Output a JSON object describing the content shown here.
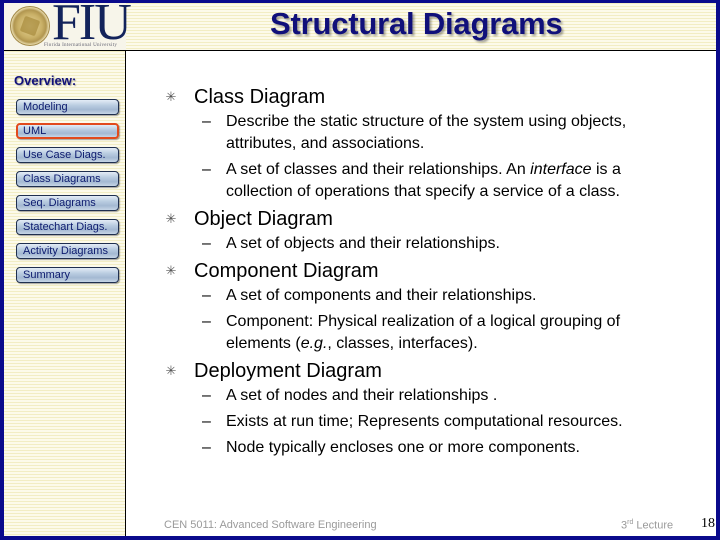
{
  "header": {
    "title": "Structural Diagrams",
    "logo_text": "FIU",
    "logo_subtitle": "Florida International University"
  },
  "sidebar": {
    "overview_label": "Overview:",
    "items": [
      {
        "label": "Modeling",
        "active": false
      },
      {
        "label": "UML",
        "active": true
      },
      {
        "label": "Use Case Diags.",
        "active": false
      },
      {
        "label": "Class Diagrams",
        "active": false
      },
      {
        "label": "Seq. Diagrams",
        "active": false
      },
      {
        "label": "Statechart Diags.",
        "active": false
      },
      {
        "label": "Activity Diagrams",
        "active": false
      },
      {
        "label": "Summary",
        "active": false
      }
    ]
  },
  "content": {
    "bullet_icon": "star-burst-icon",
    "dash": "–",
    "bullets": [
      {
        "heading": "Class Diagram",
        "subs": [
          {
            "text": "Describe the static structure of the system using objects, attributes, and associations."
          },
          {
            "pre": "A set of classes and their relationships. An ",
            "italic": "interface",
            "post": " is a collection of operations that specify a service of a class."
          }
        ]
      },
      {
        "heading": "Object Diagram",
        "subs": [
          {
            "text": "A set of objects and their relationships."
          }
        ]
      },
      {
        "heading": "Component Diagram",
        "subs": [
          {
            "text": "A set of components and their relationships."
          },
          {
            "pre": "Component: Physical realization of a logical grouping of elements (",
            "italic": "e.g.",
            "post": ", classes, interfaces)."
          }
        ]
      },
      {
        "heading": "Deployment Diagram",
        "subs": [
          {
            "text": "A set of nodes and their relationships  ."
          },
          {
            "text": "Exists at run time; Represents computational resources."
          },
          {
            "text": "Node typically encloses one or more components."
          }
        ]
      }
    ]
  },
  "footer": {
    "course": "CEN 5011: Advanced Software Engineering",
    "lecture_num": "3",
    "lecture_sup": "rd",
    "lecture_word": " Lecture",
    "page": "18"
  },
  "colors": {
    "border": "#0a0a8c",
    "title": "#10107a",
    "active_nav_border": "#e24a1c",
    "nav_text": "#0c1a6e"
  }
}
